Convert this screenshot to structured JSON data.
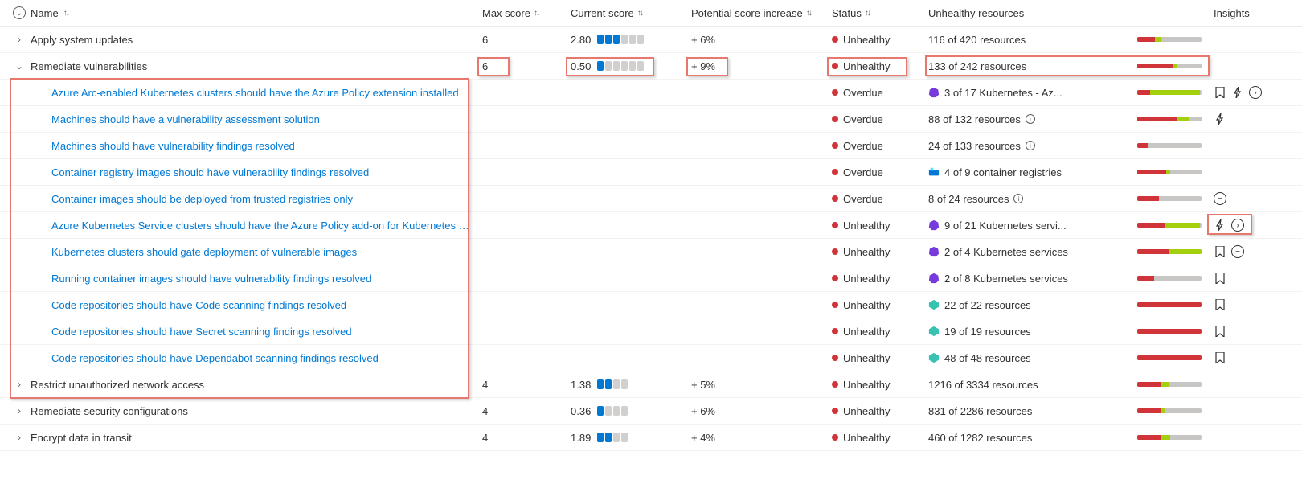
{
  "columns": {
    "name": "Name",
    "max_score": "Max score",
    "current_score": "Current score",
    "potential": "Potential score increase",
    "status": "Status",
    "unhealthy": "Unhealthy resources",
    "insights": "Insights"
  },
  "status_labels": {
    "unhealthy": "Unhealthy",
    "overdue": "Overdue"
  },
  "groups": [
    {
      "id": "apply-updates",
      "expanded": false,
      "name": "Apply system updates",
      "max_score": "6",
      "current_score": "2.80",
      "pills_total": 6,
      "pills_on": 3,
      "potential": "+ 6%",
      "status": "unhealthy",
      "resources": "116 of 420 resources",
      "bar": {
        "red": 28,
        "lime": 8,
        "gray": 64
      },
      "highlight": false
    },
    {
      "id": "remediate-vuln",
      "expanded": true,
      "name": "Remediate vulnerabilities",
      "max_score": "6",
      "current_score": "0.50",
      "pills_total": 6,
      "pills_on": 1,
      "potential": "+ 9%",
      "status": "unhealthy",
      "resources": "133 of 242 resources",
      "bar": {
        "red": 55,
        "lime": 8,
        "gray": 37
      },
      "highlight": true,
      "children": [
        {
          "name": "Azure Arc-enabled Kubernetes clusters should have the Azure Policy extension installed",
          "status": "overdue",
          "res_icon": "k8s-purple",
          "resources": "3 of 17 Kubernetes - Az...",
          "bar": {
            "red": 20,
            "lime": 78,
            "gray": 2
          },
          "insights": [
            "bookmark",
            "lightning",
            "chevron-circle"
          ]
        },
        {
          "name": "Machines should have a vulnerability assessment solution",
          "status": "overdue",
          "resources": "88 of 132 resources",
          "info": true,
          "bar": {
            "red": 62,
            "lime": 18,
            "gray": 20
          },
          "insights": [
            "lightning"
          ]
        },
        {
          "name": "Machines should have vulnerability findings resolved",
          "status": "overdue",
          "resources": "24 of 133 resources",
          "info": true,
          "bar": {
            "red": 18,
            "lime": 0,
            "gray": 82
          }
        },
        {
          "name": "Container registry images should have vulnerability findings resolved",
          "status": "overdue",
          "res_icon": "container-blue",
          "resources": "4 of 9 container registries",
          "bar": {
            "red": 45,
            "lime": 6,
            "gray": 49
          }
        },
        {
          "name": "Container images should be deployed from trusted registries only",
          "status": "overdue",
          "resources": "8 of 24 resources",
          "info": true,
          "bar": {
            "red": 34,
            "lime": 0,
            "gray": 66
          },
          "insights": [
            "deny-circle"
          ]
        },
        {
          "name": "Azure Kubernetes Service clusters should have the Azure Policy add-on for Kubernetes installed",
          "status": "unhealthy",
          "res_icon": "k8s-purple",
          "resources": "9 of 21 Kubernetes servi...",
          "bar": {
            "red": 43,
            "lime": 55,
            "gray": 2
          },
          "insights": [
            "lightning",
            "chevron-circle"
          ],
          "insights_highlight": true
        },
        {
          "name": "Kubernetes clusters should gate deployment of vulnerable images",
          "status": "unhealthy",
          "res_icon": "k8s-purple",
          "resources": "2 of 4 Kubernetes services",
          "bar": {
            "red": 50,
            "lime": 50,
            "gray": 0
          },
          "insights": [
            "bookmark",
            "deny-circle"
          ]
        },
        {
          "name": "Running container images should have vulnerability findings resolved",
          "status": "unhealthy",
          "res_icon": "k8s-purple",
          "resources": "2 of 8 Kubernetes services",
          "bar": {
            "red": 26,
            "lime": 0,
            "gray": 74
          },
          "insights": [
            "bookmark"
          ]
        },
        {
          "name": "Code repositories should have Code scanning findings resolved",
          "status": "unhealthy",
          "res_icon": "repo-teal",
          "resources": "22 of 22 resources",
          "bar": {
            "red": 100,
            "lime": 0,
            "gray": 0
          },
          "insights": [
            "bookmark"
          ]
        },
        {
          "name": "Code repositories should have Secret scanning findings resolved",
          "status": "unhealthy",
          "res_icon": "repo-teal",
          "resources": "19 of 19 resources",
          "bar": {
            "red": 100,
            "lime": 0,
            "gray": 0
          },
          "insights": [
            "bookmark"
          ]
        },
        {
          "name": "Code repositories should have Dependabot scanning findings resolved",
          "status": "unhealthy",
          "res_icon": "repo-teal",
          "resources": "48 of 48 resources",
          "bar": {
            "red": 100,
            "lime": 0,
            "gray": 0
          },
          "insights": [
            "bookmark"
          ]
        }
      ]
    },
    {
      "id": "restrict-network",
      "expanded": false,
      "name": "Restrict unauthorized network access",
      "max_score": "4",
      "current_score": "1.38",
      "pills_total": 4,
      "pills_on": 2,
      "potential": "+ 5%",
      "status": "unhealthy",
      "resources": "1216 of 3334 resources",
      "bar": {
        "red": 37,
        "lime": 12,
        "gray": 51
      }
    },
    {
      "id": "remediate-security-config",
      "expanded": false,
      "name": "Remediate security configurations",
      "max_score": "4",
      "current_score": "0.36",
      "pills_total": 4,
      "pills_on": 1,
      "potential": "+ 6%",
      "status": "unhealthy",
      "resources": "831 of 2286 resources",
      "bar": {
        "red": 37,
        "lime": 6,
        "gray": 57
      }
    },
    {
      "id": "encrypt-transit",
      "expanded": false,
      "name": "Encrypt data in transit",
      "max_score": "4",
      "current_score": "1.89",
      "pills_total": 4,
      "pills_on": 2,
      "potential": "+ 4%",
      "status": "unhealthy",
      "resources": "460 of 1282 resources",
      "bar": {
        "red": 36,
        "lime": 15,
        "gray": 49
      }
    }
  ]
}
